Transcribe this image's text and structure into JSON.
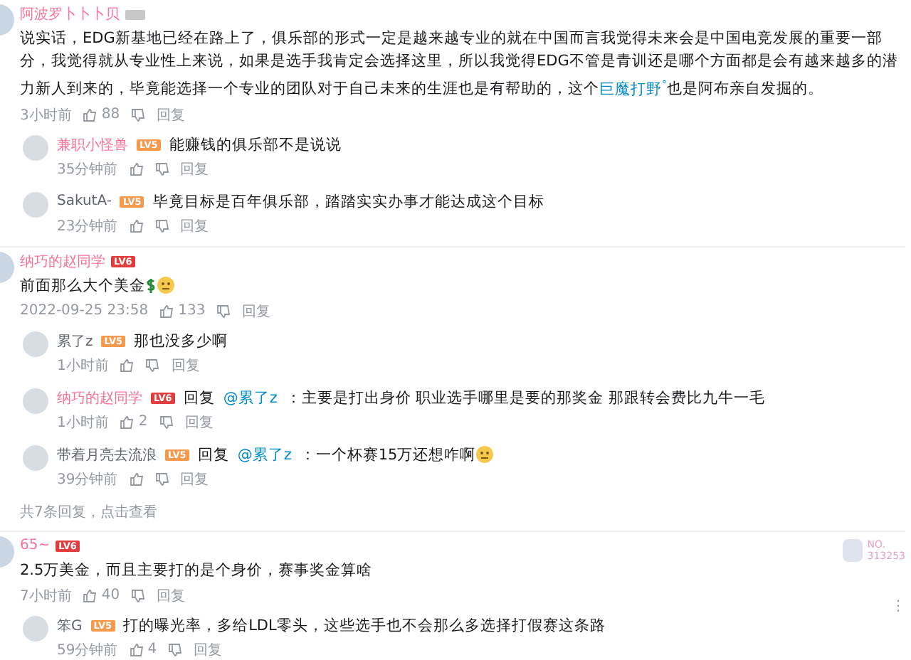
{
  "comments": [
    {
      "user": "阿波罗卜卜卜贝",
      "vip": true,
      "parts": [
        {
          "kind": "text",
          "text": "说实话，EDG新基地已经在路上了，俱乐部的形式一定是越来越专业的就在中国而言我觉得未来会是中国电竞发展的重要一部分，我觉得就从专业性上来说，如果是选手我肯定会选择这里，所以我觉得EDG不管是青训还是哪个方面都是会有越来越多的潜力新人到来的，毕竟能选择一个专业的团队对于自己未来的生涯也是有帮助的，这个"
        },
        {
          "kind": "link",
          "text": "巨魔打野",
          "suffix": "°"
        },
        {
          "kind": "text",
          "text": "也是阿布亲自发掘的。"
        }
      ],
      "time": "3小时前",
      "likes": "88",
      "reply_label": "回复",
      "replies": [
        {
          "user": "兼职小怪兽",
          "vip": true,
          "level": "LV5",
          "parts": [
            {
              "kind": "text",
              "text": "能赚钱的俱乐部不是说说"
            }
          ],
          "time": "35分钟前",
          "reply_label": "回复"
        },
        {
          "user": "SakutA-",
          "vip": false,
          "level": "LV5",
          "parts": [
            {
              "kind": "text",
              "text": "毕竟目标是百年俱乐部，踏踏实实办事才能达成这个目标"
            }
          ],
          "time": "23分钟前",
          "reply_label": "回复"
        }
      ]
    },
    {
      "user": "纳巧的赵同学",
      "vip": true,
      "level": "LV6",
      "parts": [
        {
          "kind": "text",
          "text": "前面那么大个美金"
        },
        {
          "kind": "dollar"
        },
        {
          "kind": "face"
        }
      ],
      "time": "2022-09-25 23:58",
      "likes": "133",
      "reply_label": "回复",
      "replies": [
        {
          "user": "累了z",
          "vip": false,
          "level": "LV5",
          "parts": [
            {
              "kind": "text",
              "text": "那也没多少啊"
            }
          ],
          "time": "1小时前",
          "reply_label": "回复"
        },
        {
          "user": "纳巧的赵同学",
          "vip": true,
          "level": "LV6",
          "reply_prefix": "回复",
          "reply_to": "@累了z",
          "parts": [
            {
              "kind": "text",
              "text": "：主要是打出身价 职业选手哪里是要的那奖金 那跟转会费比九牛一毛"
            }
          ],
          "time": "1小时前",
          "likes": "2",
          "reply_label": "回复"
        },
        {
          "user": "带着月亮去流浪",
          "vip": false,
          "level": "LV5",
          "reply_prefix": "回复",
          "reply_to": "@累了z",
          "parts": [
            {
              "kind": "text",
              "text": "：一个杯赛15万还想咋啊"
            },
            {
              "kind": "face"
            }
          ],
          "time": "39分钟前",
          "reply_label": "回复"
        }
      ],
      "more_replies": "共7条回复，点击查看"
    },
    {
      "user": "65~",
      "vip": true,
      "level": "LV6",
      "fan_badge": {
        "line1": "NO.",
        "line2": "313253"
      },
      "menu_glyph": "⋮",
      "parts": [
        {
          "kind": "text",
          "text": "2.5万美金，而且主要打的是个身价，赛事奖金算啥"
        }
      ],
      "time": "7小时前",
      "likes": "40",
      "reply_label": "回复",
      "replies": [
        {
          "user": "笨G",
          "vip": false,
          "level": "LV5",
          "parts": [
            {
              "kind": "text",
              "text": "打的曝光率，多给LDL零头，这些选手也不会那么多选择打假赛这条路"
            }
          ],
          "time": "59分钟前",
          "likes": "4",
          "reply_label": "回复"
        }
      ]
    }
  ]
}
